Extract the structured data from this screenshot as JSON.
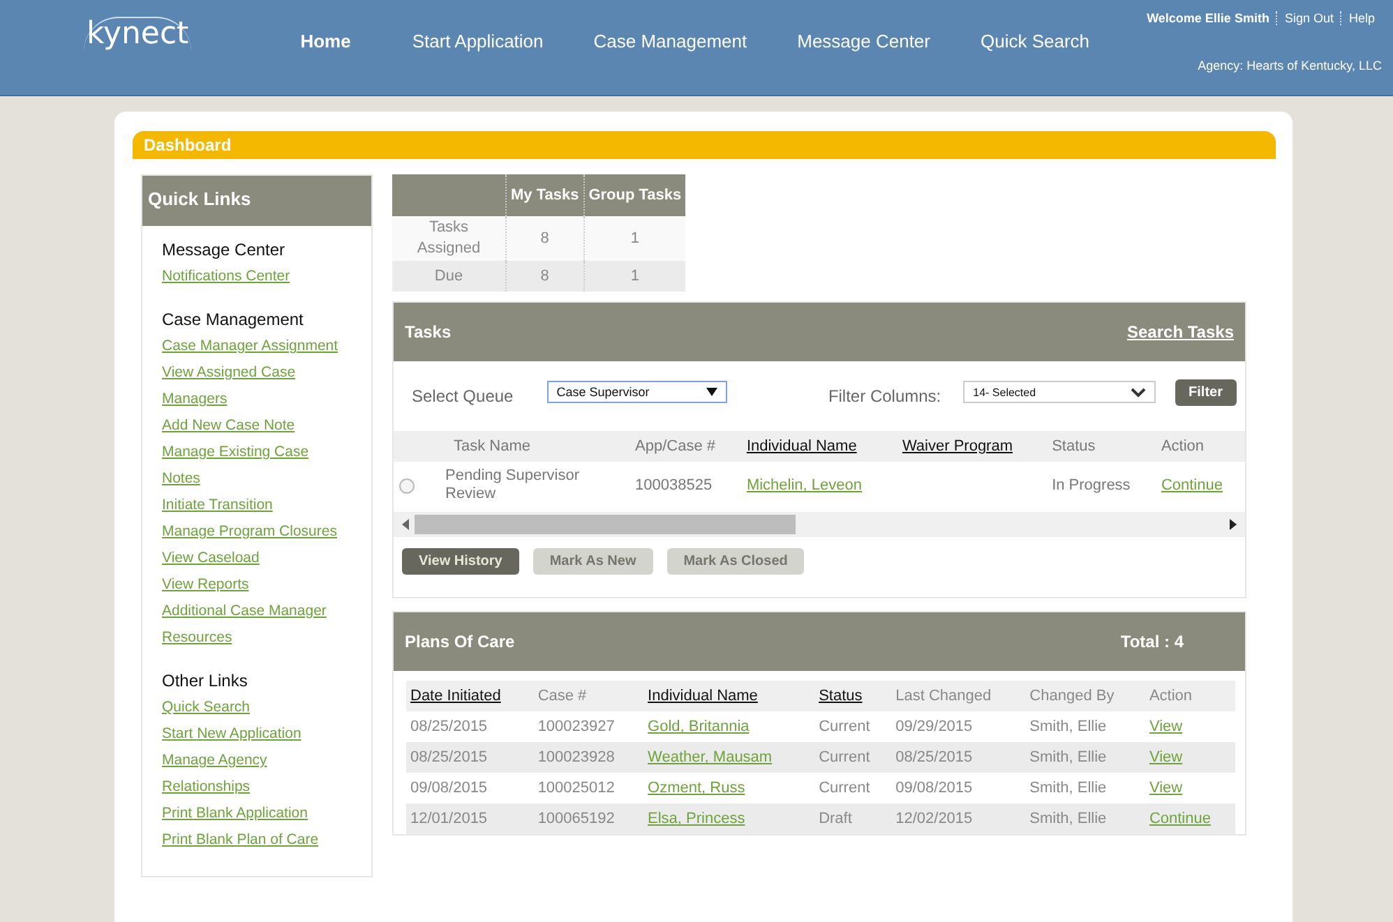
{
  "header": {
    "logo": "kynect",
    "nav": [
      {
        "label": "Home",
        "selected": true
      },
      {
        "label": "Start Application",
        "selected": false
      },
      {
        "label": "Case Management",
        "selected": false
      },
      {
        "label": "Message Center",
        "selected": false
      },
      {
        "label": "Quick Search",
        "selected": false
      }
    ],
    "user_links": [
      "Welcome Ellie Smith",
      "Sign Out",
      "Help"
    ],
    "agency": "Agency: Hearts of Kentucky, LLC"
  },
  "dashboard_title": "Dashboard",
  "quick_links": {
    "title": "Quick Links",
    "sections": [
      {
        "heading": "Message Center",
        "links": [
          "Notifications Center"
        ]
      },
      {
        "heading": "Case Management",
        "links": [
          "Case Manager Assignment",
          "View Assigned Case Managers",
          "Add New Case Note",
          "Manage Existing Case Notes",
          "Initiate Transition",
          "Manage Program Closures",
          "View Caseload",
          "View Reports",
          "Additional Case Manager Resources"
        ]
      },
      {
        "heading": "Other Links",
        "links": [
          "Quick Search",
          "Start New Application",
          "Manage Agency Relationships",
          "Print Blank Application",
          "Print Blank Plan of Care"
        ]
      }
    ]
  },
  "summary": {
    "columns": [
      "My Tasks",
      "Group Tasks"
    ],
    "rows": [
      {
        "label": "Tasks Assigned",
        "values": [
          "8",
          "1"
        ]
      },
      {
        "label": "Due",
        "values": [
          "8",
          "1"
        ]
      }
    ]
  },
  "tasks": {
    "title": "Tasks",
    "search_link": "Search Tasks",
    "queue_label": "Select Queue",
    "queue_value": "Case Supervisor",
    "filter_label": "Filter Columns:",
    "filter_value": "14- Selected",
    "filter_button": "Filter",
    "columns": [
      {
        "label": "Task Name",
        "sortable": false
      },
      {
        "label": "App/Case #",
        "sortable": false
      },
      {
        "label": "Individual Name",
        "sortable": true
      },
      {
        "label": "Waiver Program",
        "sortable": true
      },
      {
        "label": "Status",
        "sortable": false
      },
      {
        "label": "Action",
        "sortable": false
      }
    ],
    "rows": [
      {
        "selected": false,
        "task": "Pending Supervisor Review",
        "case": "100038525",
        "name": "Michelin, Leveon",
        "status": "In Progress",
        "action": "Continue"
      }
    ],
    "buttons": [
      {
        "label": "View History",
        "disabled": false
      },
      {
        "label": "Mark As New",
        "disabled": true
      },
      {
        "label": "Mark As Closed",
        "disabled": true
      }
    ]
  },
  "plans": {
    "title": "Plans Of Care",
    "total": "Total : 4",
    "columns": [
      {
        "label": "Date Initiated",
        "sortable": true
      },
      {
        "label": "Case #",
        "sortable": false
      },
      {
        "label": "Individual Name",
        "sortable": true
      },
      {
        "label": "Status",
        "sortable": true
      },
      {
        "label": "Last Changed",
        "sortable": false
      },
      {
        "label": "Changed By",
        "sortable": false
      },
      {
        "label": "Action",
        "sortable": false
      }
    ],
    "rows": [
      {
        "date": "08/25/2015",
        "case": "100023927",
        "name": "Gold, Britannia",
        "status": "Current",
        "changed": "09/29/2015",
        "by": "Smith, Ellie",
        "action": "View"
      },
      {
        "date": "08/25/2015",
        "case": "100023928",
        "name": "Weather, Mausam",
        "status": "Current",
        "changed": "08/25/2015",
        "by": "Smith, Ellie",
        "action": "View"
      },
      {
        "date": "09/08/2015",
        "case": "100025012",
        "name": "Ozment, Russ",
        "status": "Current",
        "changed": "09/08/2015",
        "by": "Smith, Ellie",
        "action": "View"
      },
      {
        "date": "12/01/2015",
        "case": "100065192",
        "name": "Elsa, Princess",
        "status": "Draft",
        "changed": "12/02/2015",
        "by": "Smith, Ellie",
        "action": "Continue"
      }
    ]
  }
}
